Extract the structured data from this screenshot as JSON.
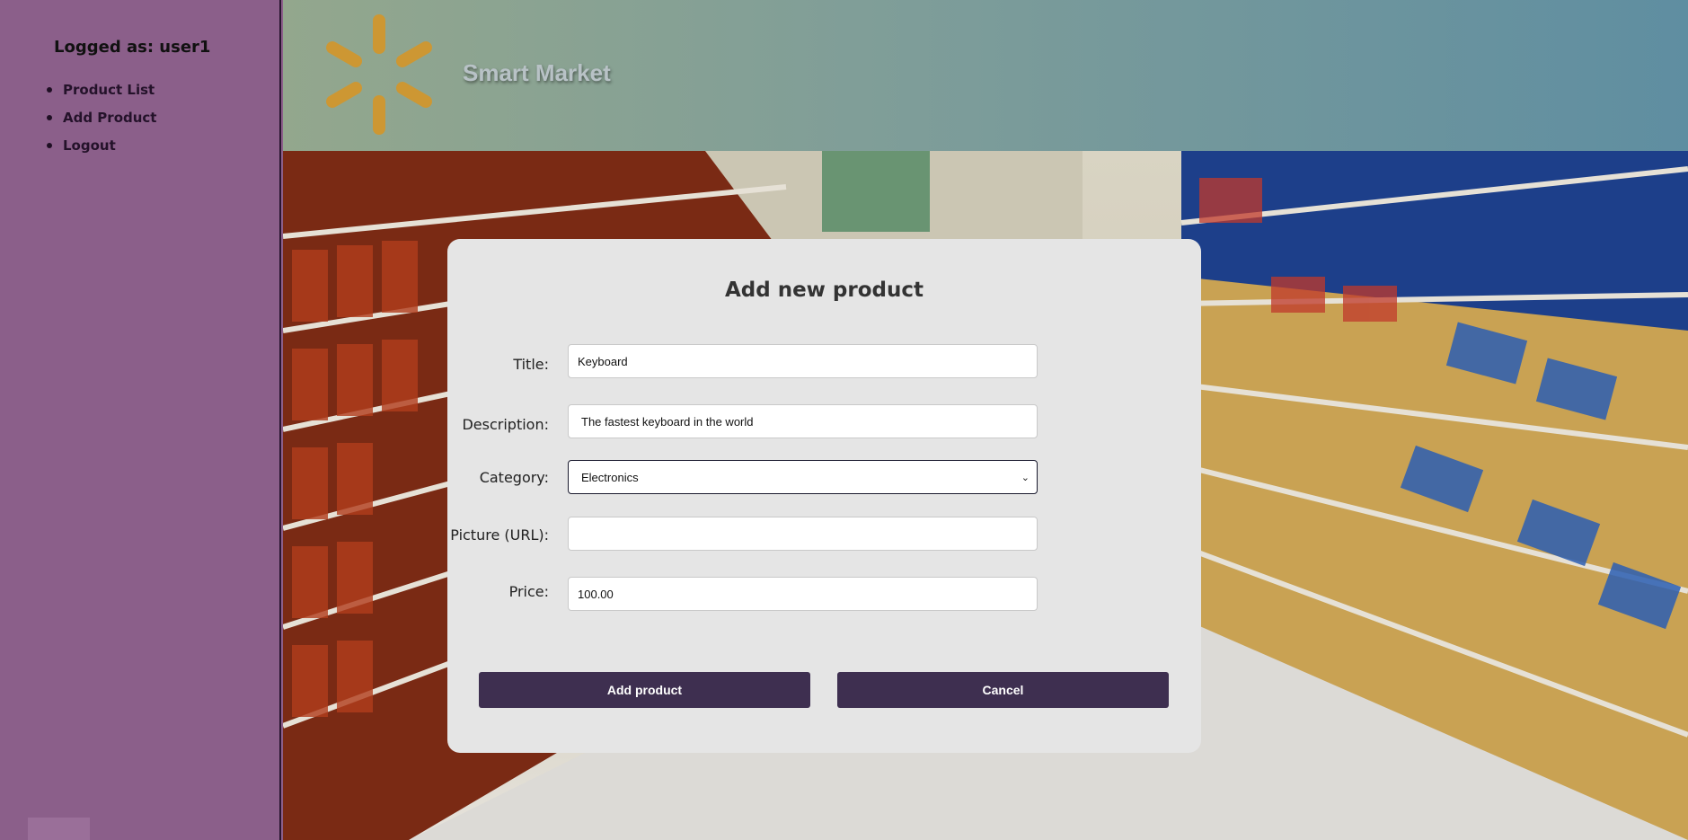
{
  "sidebar": {
    "logged_as": "Logged as: user1",
    "items": [
      {
        "label": "Product List"
      },
      {
        "label": "Add Product"
      },
      {
        "label": "Logout"
      }
    ]
  },
  "header": {
    "brand": "Smart Market",
    "logo_color": "#d4962a"
  },
  "form": {
    "heading": "Add new product",
    "title_label": "Title:",
    "title_value": "Keyboard",
    "description_label": "Description:",
    "description_value": "The fastest keyboard in the world",
    "category_label": "Category:",
    "category_value": "Electronics",
    "picture_label": "Picture (URL):",
    "picture_value": "",
    "price_label": "Price:",
    "price_value": "100.00",
    "submit_label": "Add product",
    "cancel_label": "Cancel"
  },
  "colors": {
    "sidebar_bg": "#8b5f8a",
    "button_bg": "#3e2f50",
    "card_bg": "#e5e5e5"
  }
}
